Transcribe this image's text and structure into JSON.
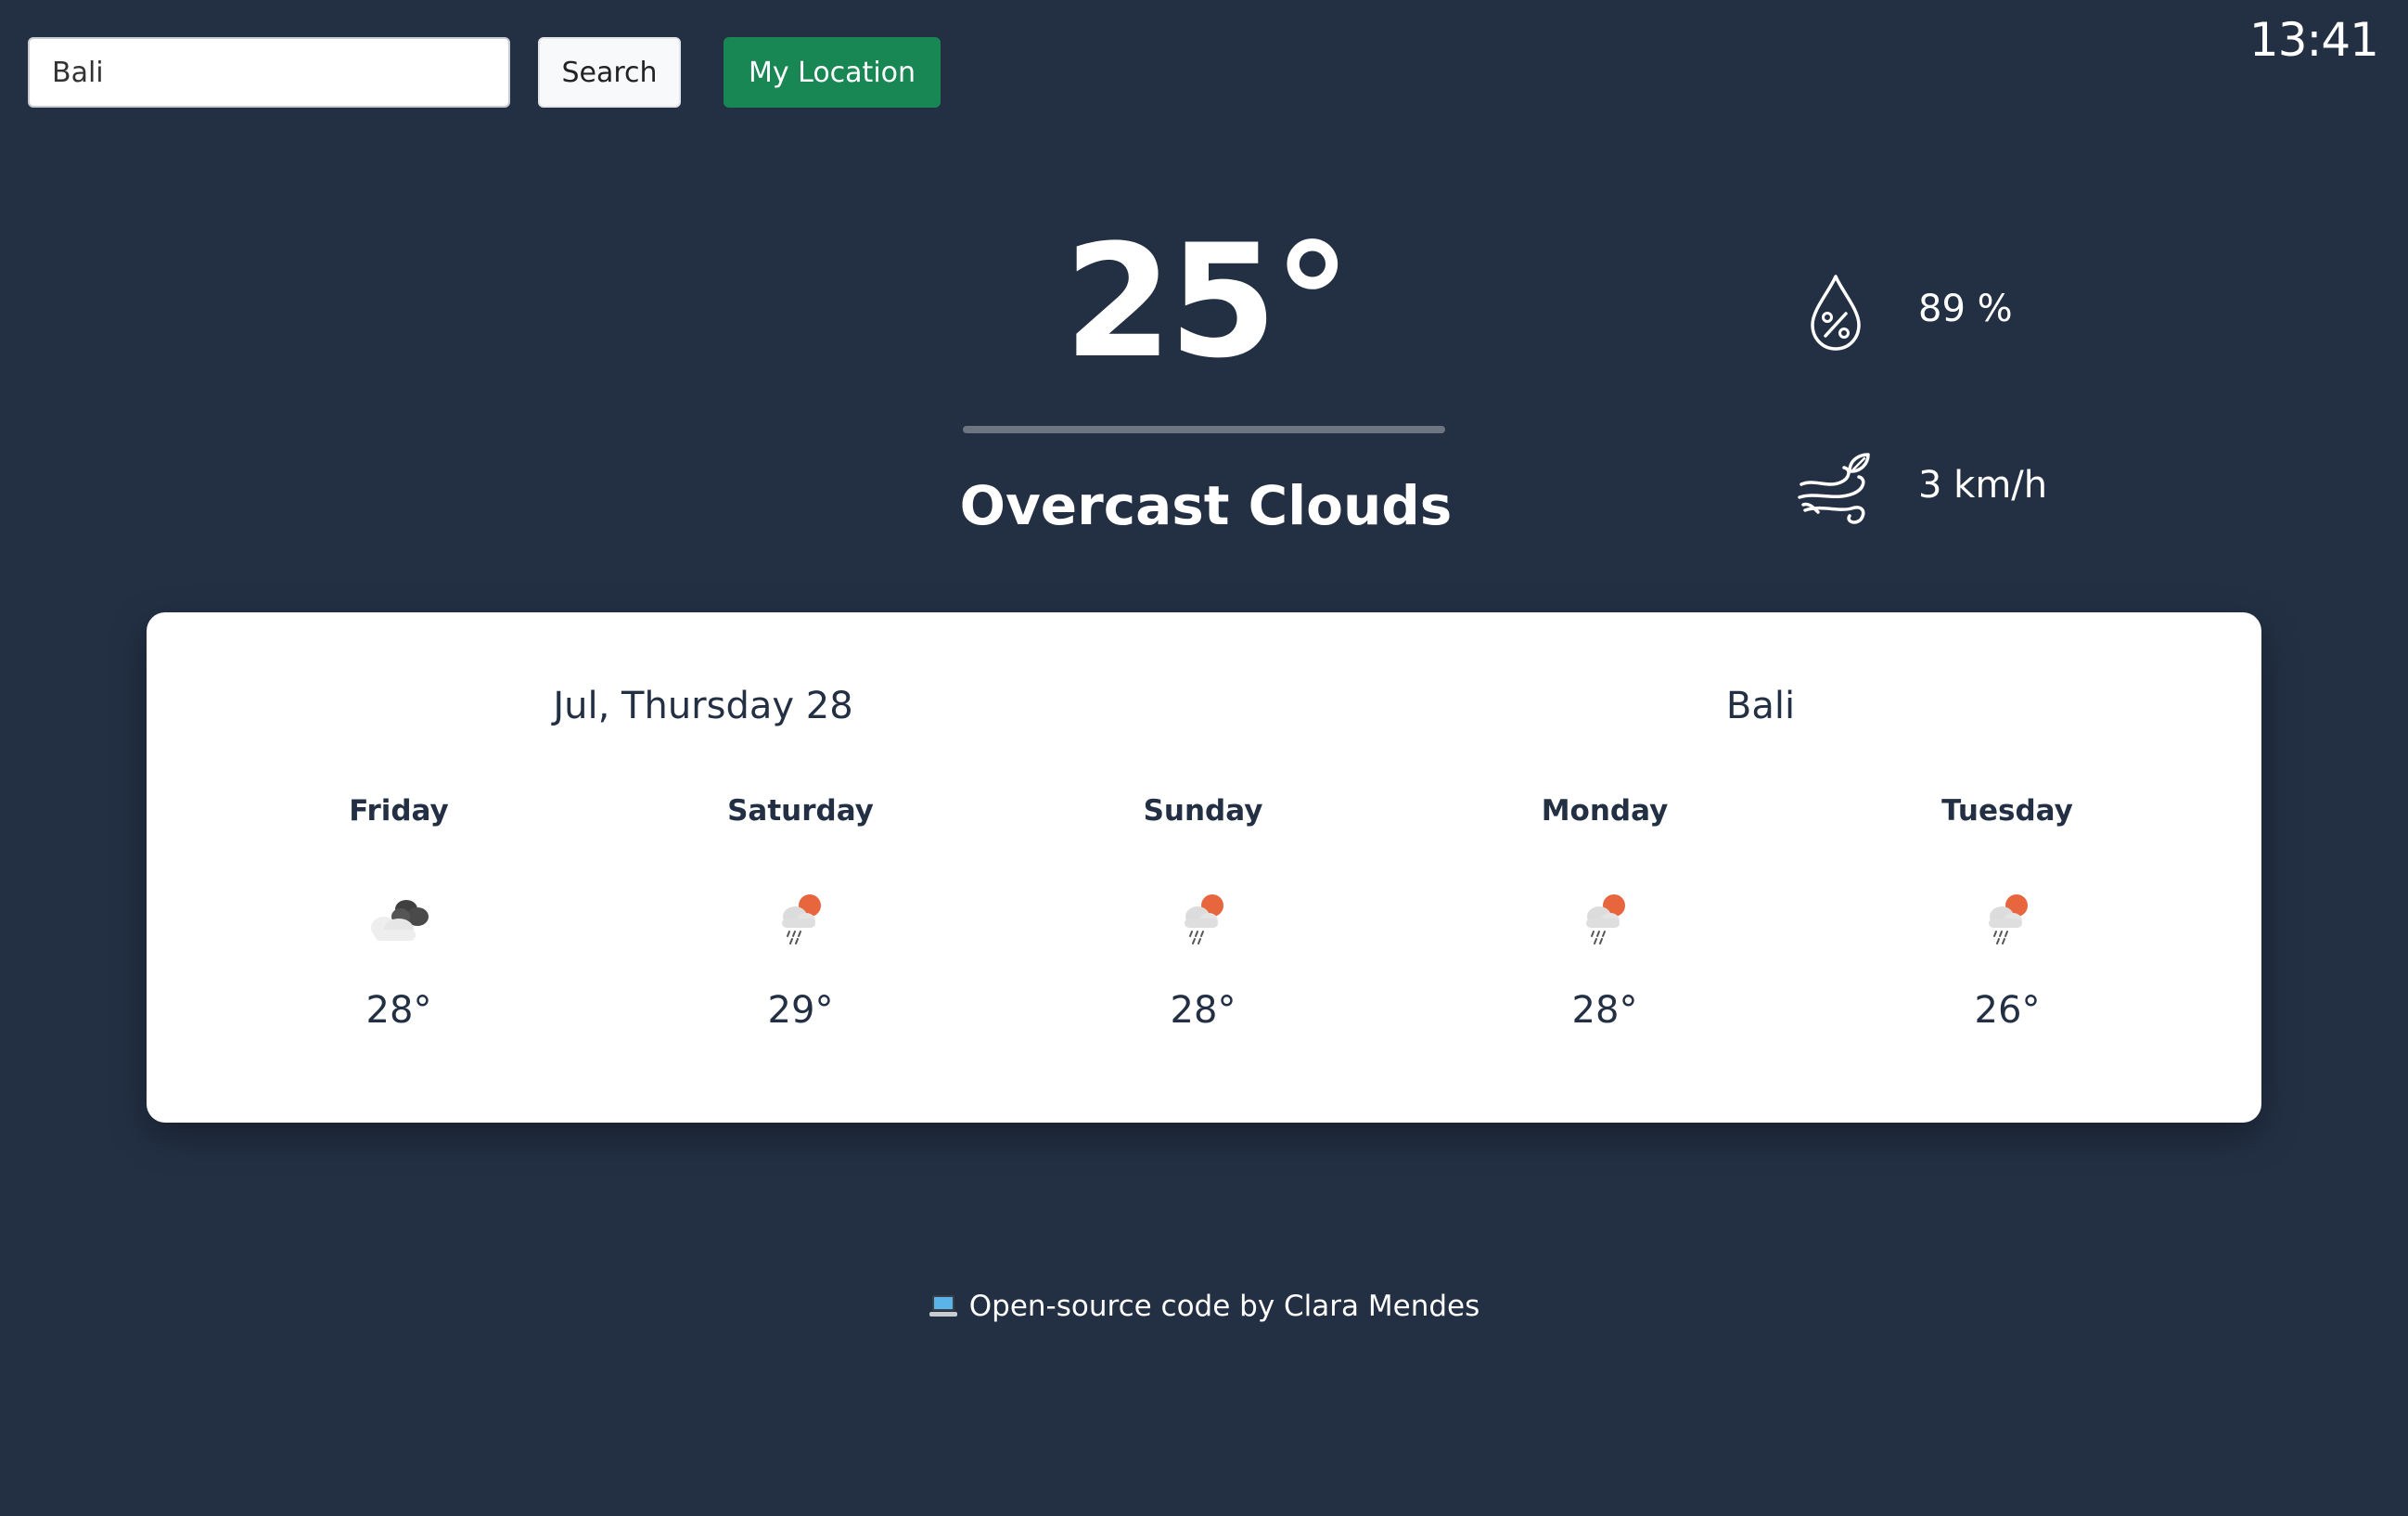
{
  "search": {
    "value": "Bali",
    "button_label": "Search",
    "location_label": "My Location"
  },
  "clock": "13:41",
  "current": {
    "temperature": "25°",
    "condition": "Overcast Clouds",
    "humidity": "89 %",
    "humidity_icon": "humidity-drop-percent",
    "wind": "3 km/h",
    "wind_icon": "wind-leaf"
  },
  "forecast": {
    "date": "Jul, Thursday 28",
    "city": "Bali",
    "days": [
      {
        "name": "Friday",
        "temp": "28°",
        "icon": "broken-clouds"
      },
      {
        "name": "Saturday",
        "temp": "29°",
        "icon": "rain-sun"
      },
      {
        "name": "Sunday",
        "temp": "28°",
        "icon": "rain-sun"
      },
      {
        "name": "Monday",
        "temp": "28°",
        "icon": "rain-sun"
      },
      {
        "name": "Tuesday",
        "temp": "26°",
        "icon": "rain-sun"
      }
    ]
  },
  "footer": {
    "icon": "laptop-icon",
    "text": "Open-source code by Clara Mendes"
  },
  "colors": {
    "background": "#233044",
    "card": "#ffffff",
    "location_button": "#198754",
    "sun": "#e8663d"
  }
}
